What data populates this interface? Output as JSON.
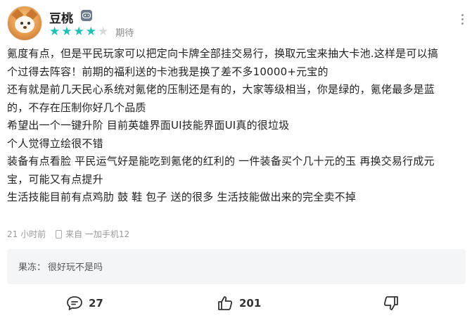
{
  "user": {
    "name": "豆桃",
    "rating_stars": 4,
    "rating_max": 5,
    "rating_label": "期待"
  },
  "content": [
    "氪度有点，但是平民玩家可以把定向卡牌全部挂交易行，换取元宝来抽大卡池.这样是可以搞",
    "个过得去阵容！前期的福利送的卡池我是换了差不多10000+元宝的",
    "还有就是前几天民心系统对氪佬的压制还是有的，大家等级相当，你是绿的，氪佬最多是蓝",
    "的，不存在压制你好几个品质",
    "希望出一个一键升阶 目前英雄界面UI技能界面UI真的很垃圾",
    "个人觉得立绘很不错",
    "装备有点看脸 平民运气好是能吃到氪佬的红利的 一件装备买个几十元的玉 再换交易行成元",
    "宝，可能又有点提升",
    "生活技能目前有点鸡肋 鼓 鞋 包子 送的很多 生活技能做出来的完全卖不掉"
  ],
  "meta": {
    "time": "21 小时前",
    "device": "来自 一加手机12"
  },
  "reply": {
    "author": "果冻：",
    "text": "很好玩不是吗"
  },
  "actions": {
    "comments": "27",
    "likes": "201"
  },
  "colors": {
    "star_on": "#19c3b4",
    "star_off": "#d8d8d8"
  }
}
